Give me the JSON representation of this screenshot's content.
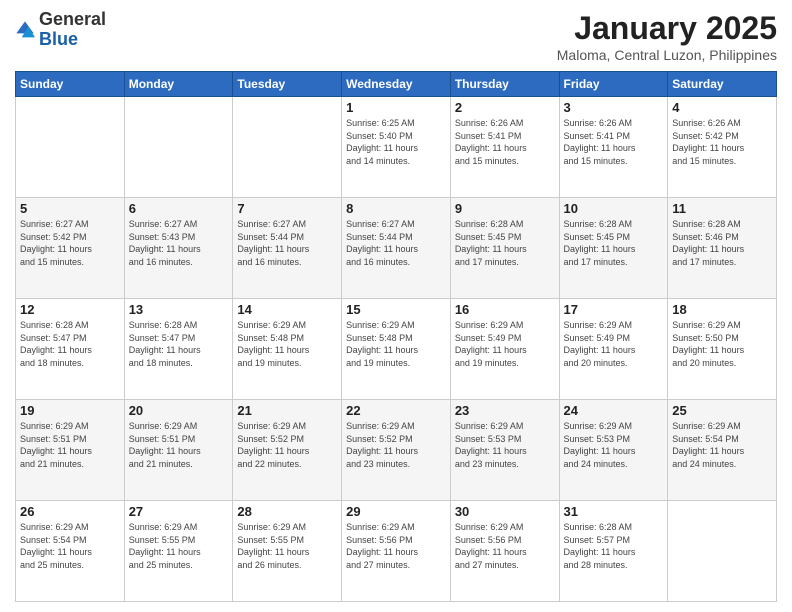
{
  "header": {
    "logo": {
      "line1": "General",
      "line2": "Blue"
    },
    "title": "January 2025",
    "location": "Maloma, Central Luzon, Philippines"
  },
  "days_of_week": [
    "Sunday",
    "Monday",
    "Tuesday",
    "Wednesday",
    "Thursday",
    "Friday",
    "Saturday"
  ],
  "weeks": [
    [
      {
        "day": "",
        "info": ""
      },
      {
        "day": "",
        "info": ""
      },
      {
        "day": "",
        "info": ""
      },
      {
        "day": "1",
        "info": "Sunrise: 6:25 AM\nSunset: 5:40 PM\nDaylight: 11 hours\nand 14 minutes."
      },
      {
        "day": "2",
        "info": "Sunrise: 6:26 AM\nSunset: 5:41 PM\nDaylight: 11 hours\nand 15 minutes."
      },
      {
        "day": "3",
        "info": "Sunrise: 6:26 AM\nSunset: 5:41 PM\nDaylight: 11 hours\nand 15 minutes."
      },
      {
        "day": "4",
        "info": "Sunrise: 6:26 AM\nSunset: 5:42 PM\nDaylight: 11 hours\nand 15 minutes."
      }
    ],
    [
      {
        "day": "5",
        "info": "Sunrise: 6:27 AM\nSunset: 5:42 PM\nDaylight: 11 hours\nand 15 minutes."
      },
      {
        "day": "6",
        "info": "Sunrise: 6:27 AM\nSunset: 5:43 PM\nDaylight: 11 hours\nand 16 minutes."
      },
      {
        "day": "7",
        "info": "Sunrise: 6:27 AM\nSunset: 5:44 PM\nDaylight: 11 hours\nand 16 minutes."
      },
      {
        "day": "8",
        "info": "Sunrise: 6:27 AM\nSunset: 5:44 PM\nDaylight: 11 hours\nand 16 minutes."
      },
      {
        "day": "9",
        "info": "Sunrise: 6:28 AM\nSunset: 5:45 PM\nDaylight: 11 hours\nand 17 minutes."
      },
      {
        "day": "10",
        "info": "Sunrise: 6:28 AM\nSunset: 5:45 PM\nDaylight: 11 hours\nand 17 minutes."
      },
      {
        "day": "11",
        "info": "Sunrise: 6:28 AM\nSunset: 5:46 PM\nDaylight: 11 hours\nand 17 minutes."
      }
    ],
    [
      {
        "day": "12",
        "info": "Sunrise: 6:28 AM\nSunset: 5:47 PM\nDaylight: 11 hours\nand 18 minutes."
      },
      {
        "day": "13",
        "info": "Sunrise: 6:28 AM\nSunset: 5:47 PM\nDaylight: 11 hours\nand 18 minutes."
      },
      {
        "day": "14",
        "info": "Sunrise: 6:29 AM\nSunset: 5:48 PM\nDaylight: 11 hours\nand 19 minutes."
      },
      {
        "day": "15",
        "info": "Sunrise: 6:29 AM\nSunset: 5:48 PM\nDaylight: 11 hours\nand 19 minutes."
      },
      {
        "day": "16",
        "info": "Sunrise: 6:29 AM\nSunset: 5:49 PM\nDaylight: 11 hours\nand 19 minutes."
      },
      {
        "day": "17",
        "info": "Sunrise: 6:29 AM\nSunset: 5:49 PM\nDaylight: 11 hours\nand 20 minutes."
      },
      {
        "day": "18",
        "info": "Sunrise: 6:29 AM\nSunset: 5:50 PM\nDaylight: 11 hours\nand 20 minutes."
      }
    ],
    [
      {
        "day": "19",
        "info": "Sunrise: 6:29 AM\nSunset: 5:51 PM\nDaylight: 11 hours\nand 21 minutes."
      },
      {
        "day": "20",
        "info": "Sunrise: 6:29 AM\nSunset: 5:51 PM\nDaylight: 11 hours\nand 21 minutes."
      },
      {
        "day": "21",
        "info": "Sunrise: 6:29 AM\nSunset: 5:52 PM\nDaylight: 11 hours\nand 22 minutes."
      },
      {
        "day": "22",
        "info": "Sunrise: 6:29 AM\nSunset: 5:52 PM\nDaylight: 11 hours\nand 23 minutes."
      },
      {
        "day": "23",
        "info": "Sunrise: 6:29 AM\nSunset: 5:53 PM\nDaylight: 11 hours\nand 23 minutes."
      },
      {
        "day": "24",
        "info": "Sunrise: 6:29 AM\nSunset: 5:53 PM\nDaylight: 11 hours\nand 24 minutes."
      },
      {
        "day": "25",
        "info": "Sunrise: 6:29 AM\nSunset: 5:54 PM\nDaylight: 11 hours\nand 24 minutes."
      }
    ],
    [
      {
        "day": "26",
        "info": "Sunrise: 6:29 AM\nSunset: 5:54 PM\nDaylight: 11 hours\nand 25 minutes."
      },
      {
        "day": "27",
        "info": "Sunrise: 6:29 AM\nSunset: 5:55 PM\nDaylight: 11 hours\nand 25 minutes."
      },
      {
        "day": "28",
        "info": "Sunrise: 6:29 AM\nSunset: 5:55 PM\nDaylight: 11 hours\nand 26 minutes."
      },
      {
        "day": "29",
        "info": "Sunrise: 6:29 AM\nSunset: 5:56 PM\nDaylight: 11 hours\nand 27 minutes."
      },
      {
        "day": "30",
        "info": "Sunrise: 6:29 AM\nSunset: 5:56 PM\nDaylight: 11 hours\nand 27 minutes."
      },
      {
        "day": "31",
        "info": "Sunrise: 6:28 AM\nSunset: 5:57 PM\nDaylight: 11 hours\nand 28 minutes."
      },
      {
        "day": "",
        "info": ""
      }
    ]
  ]
}
